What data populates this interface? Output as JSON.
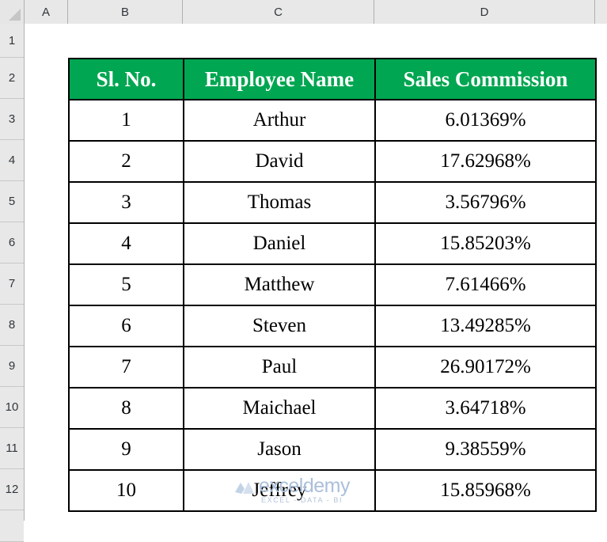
{
  "spreadsheet": {
    "corner_icon": "select-all-triangle-icon",
    "column_headers": [
      "A",
      "B",
      "C",
      "D"
    ],
    "row_headers": [
      "1",
      "2",
      "3",
      "4",
      "5",
      "6",
      "7",
      "8",
      "9",
      "10",
      "11",
      "12"
    ],
    "header_fill_color": "#00a651",
    "header_text_color": "#ffffff",
    "grid_line_color": "#c8c8c8",
    "table_border_color": "#000000"
  },
  "table": {
    "columns": [
      "Sl. No.",
      "Employee Name",
      "Sales Commission"
    ],
    "rows": [
      {
        "sl_no": "1",
        "employee_name": "Arthur",
        "sales_commission": "6.01369%"
      },
      {
        "sl_no": "2",
        "employee_name": "David",
        "sales_commission": "17.62968%"
      },
      {
        "sl_no": "3",
        "employee_name": "Thomas",
        "sales_commission": "3.56796%"
      },
      {
        "sl_no": "4",
        "employee_name": "Daniel",
        "sales_commission": "15.85203%"
      },
      {
        "sl_no": "5",
        "employee_name": "Matthew",
        "sales_commission": "7.61466%"
      },
      {
        "sl_no": "6",
        "employee_name": "Steven",
        "sales_commission": "13.49285%"
      },
      {
        "sl_no": "7",
        "employee_name": "Paul",
        "sales_commission": "26.90172%"
      },
      {
        "sl_no": "8",
        "employee_name": "Maichael",
        "sales_commission": "3.64718%"
      },
      {
        "sl_no": "9",
        "employee_name": "Jason",
        "sales_commission": "9.38559%"
      },
      {
        "sl_no": "10",
        "employee_name": "Jeffrey",
        "sales_commission": "15.85968%"
      }
    ]
  },
  "watermark": {
    "text": "exceldemy",
    "tagline": "EXCEL - DATA - BI",
    "color": "#aabfdb"
  }
}
